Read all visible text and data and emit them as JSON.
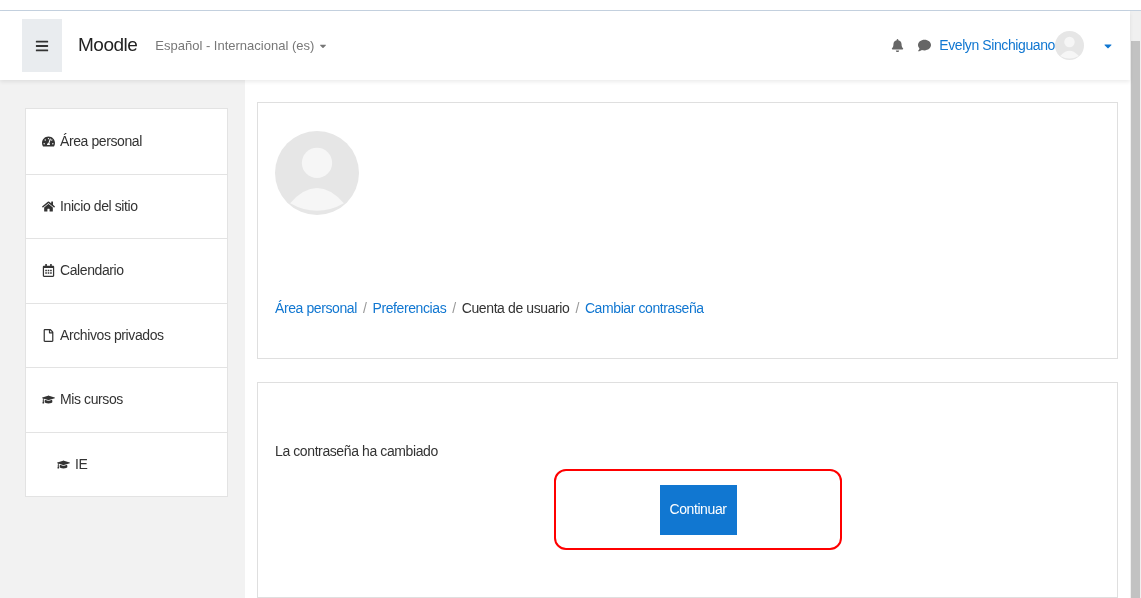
{
  "navbar": {
    "brand": "Moodle",
    "language": "Español - Internacional (es)",
    "user": "Evelyn Sinchiguano"
  },
  "sidebar": {
    "items": [
      {
        "kind": "dashboard",
        "label": "Área personal"
      },
      {
        "kind": "home",
        "label": "Inicio del sitio"
      },
      {
        "kind": "calendar",
        "label": "Calendario"
      },
      {
        "kind": "file",
        "label": "Archivos privados"
      },
      {
        "kind": "course",
        "label": "Mis cursos",
        "children": [
          {
            "kind": "course",
            "label": "IE"
          }
        ]
      }
    ]
  },
  "breadcrumb": [
    {
      "kind": "link",
      "label": "Área personal"
    },
    {
      "kind": "link",
      "label": "Preferencias",
      "separator": "/"
    },
    {
      "kind": "text",
      "label": "Cuenta de usuario",
      "separator": "/"
    },
    {
      "kind": "link",
      "label": "Cambiar contraseña",
      "separator": "/"
    }
  ],
  "message": "La contraseña ha cambiado",
  "continue_button": {
    "label": "Continuar",
    "highlighted": true
  }
}
